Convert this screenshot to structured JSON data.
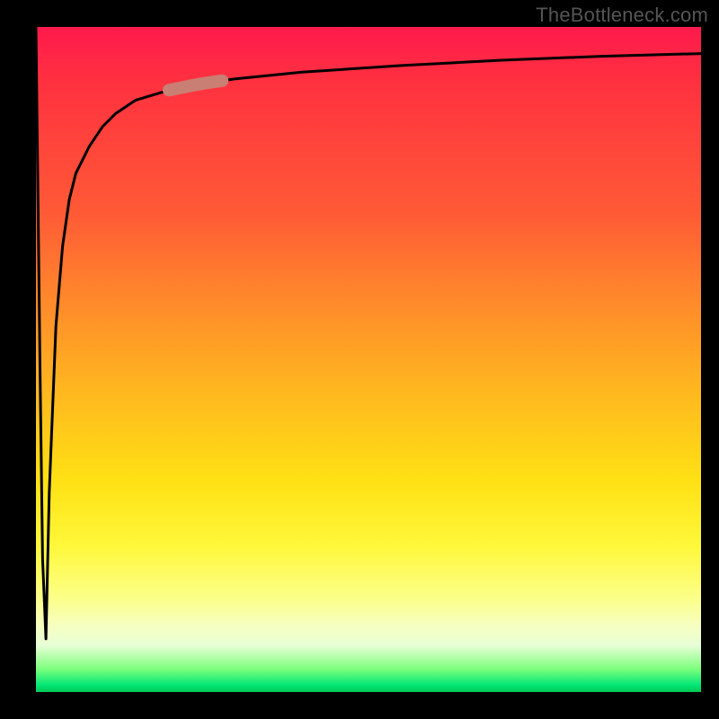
{
  "watermark": "TheBottleneck.com",
  "colors": {
    "background": "#000000",
    "gradient_top": "#ff1a4d",
    "gradient_mid1": "#ff8c2a",
    "gradient_mid2": "#ffe014",
    "gradient_mid3": "#fcff8a",
    "gradient_bottom": "#00c853",
    "curve": "#000000",
    "highlight": "#c97f74"
  },
  "chart_data": {
    "type": "line",
    "title": "",
    "xlabel": "",
    "ylabel": "",
    "xlim": [
      0,
      100
    ],
    "ylim": [
      0,
      100
    ],
    "grid": false,
    "legend": false,
    "series": [
      {
        "name": "bottleneck-curve",
        "x": [
          0,
          0.6,
          1.0,
          1.5,
          2,
          3,
          4,
          5,
          6,
          8,
          10,
          12,
          15,
          20,
          25,
          30,
          40,
          55,
          70,
          85,
          100
        ],
        "values": [
          100,
          50,
          20,
          8,
          30,
          55,
          67,
          74,
          78,
          82,
          85,
          87,
          89,
          90.5,
          91.5,
          92.2,
          93.2,
          94.2,
          95,
          95.6,
          96
        ]
      }
    ],
    "annotations": [
      {
        "name": "highlight-segment",
        "x_range": [
          20,
          28
        ],
        "note": "pink-brown thick segment on curve"
      }
    ]
  }
}
